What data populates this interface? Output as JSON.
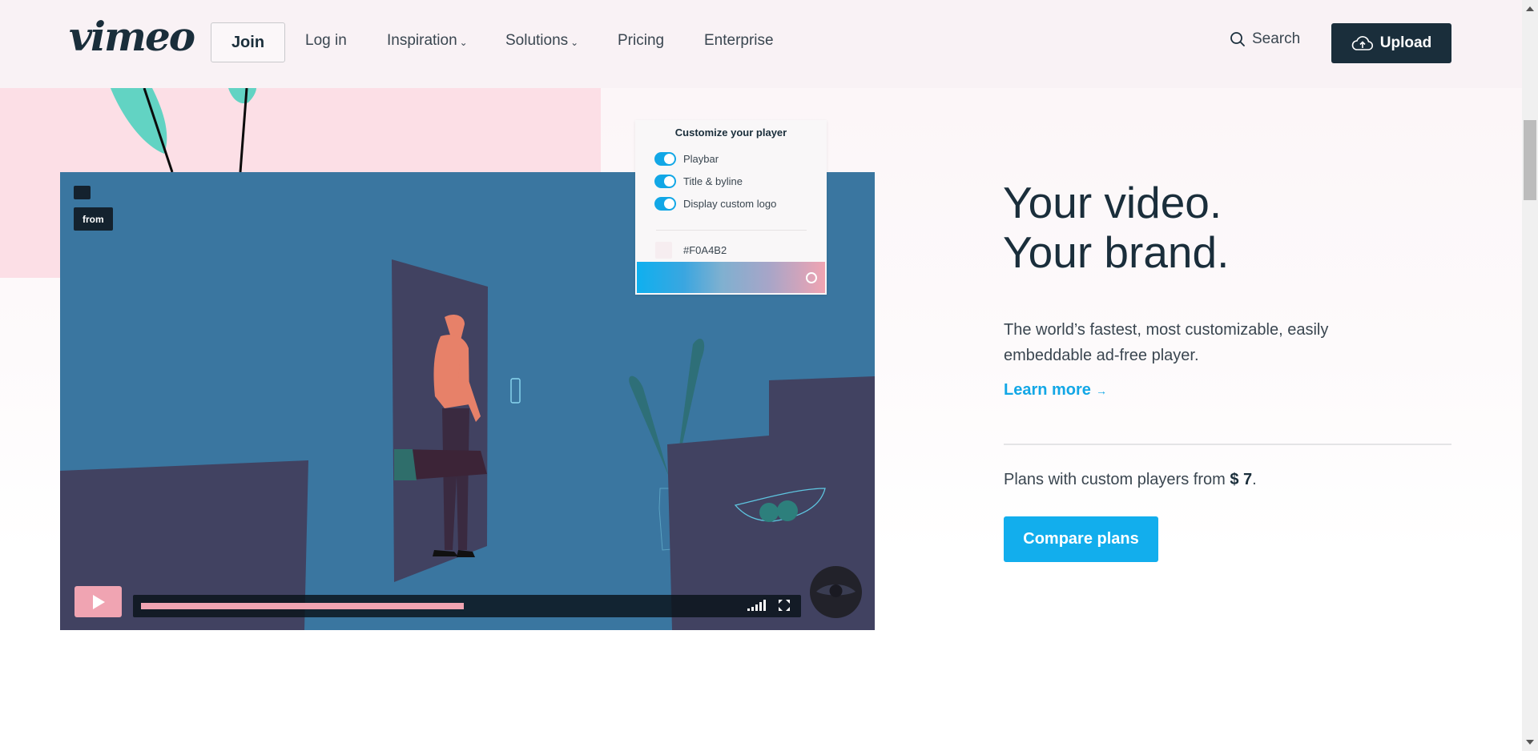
{
  "header": {
    "logo": "vimeo",
    "join_label": "Join",
    "nav": [
      {
        "label": "Log in",
        "has_dropdown": false
      },
      {
        "label": "Inspiration",
        "has_dropdown": true
      },
      {
        "label": "Solutions",
        "has_dropdown": true
      },
      {
        "label": "Pricing",
        "has_dropdown": false
      },
      {
        "label": "Enterprise",
        "has_dropdown": false
      }
    ],
    "search_label": "Search",
    "upload_label": "Upload",
    "chevron": "⌄"
  },
  "video_player": {
    "badge_text": "from",
    "progress_percent": 49,
    "icons": [
      "play-icon",
      "volume-icon",
      "fullscreen-icon",
      "eye-icon"
    ]
  },
  "customize_panel": {
    "title": "Customize your player",
    "toggles": [
      {
        "label": "Playbar",
        "on": true
      },
      {
        "label": "Title & byline",
        "on": true
      },
      {
        "label": "Display custom logo",
        "on": true
      }
    ],
    "color_hex": "#F0A4B2"
  },
  "hero": {
    "headline_line1": "Your video.",
    "headline_line2": "Your brand.",
    "description": "The world’s fastest, most customizable, easily embeddable ad-free player.",
    "learn_more": "Learn more",
    "learn_more_arrow": "→",
    "plans_prefix": "Plans with custom players from",
    "plans_price": "$ 7",
    "plans_suffix": ".",
    "compare_label": "Compare plans"
  },
  "colors": {
    "brand_dark": "#1a2e3b",
    "accent_blue": "#12aeed",
    "player_pink": "#F0A4B2"
  }
}
